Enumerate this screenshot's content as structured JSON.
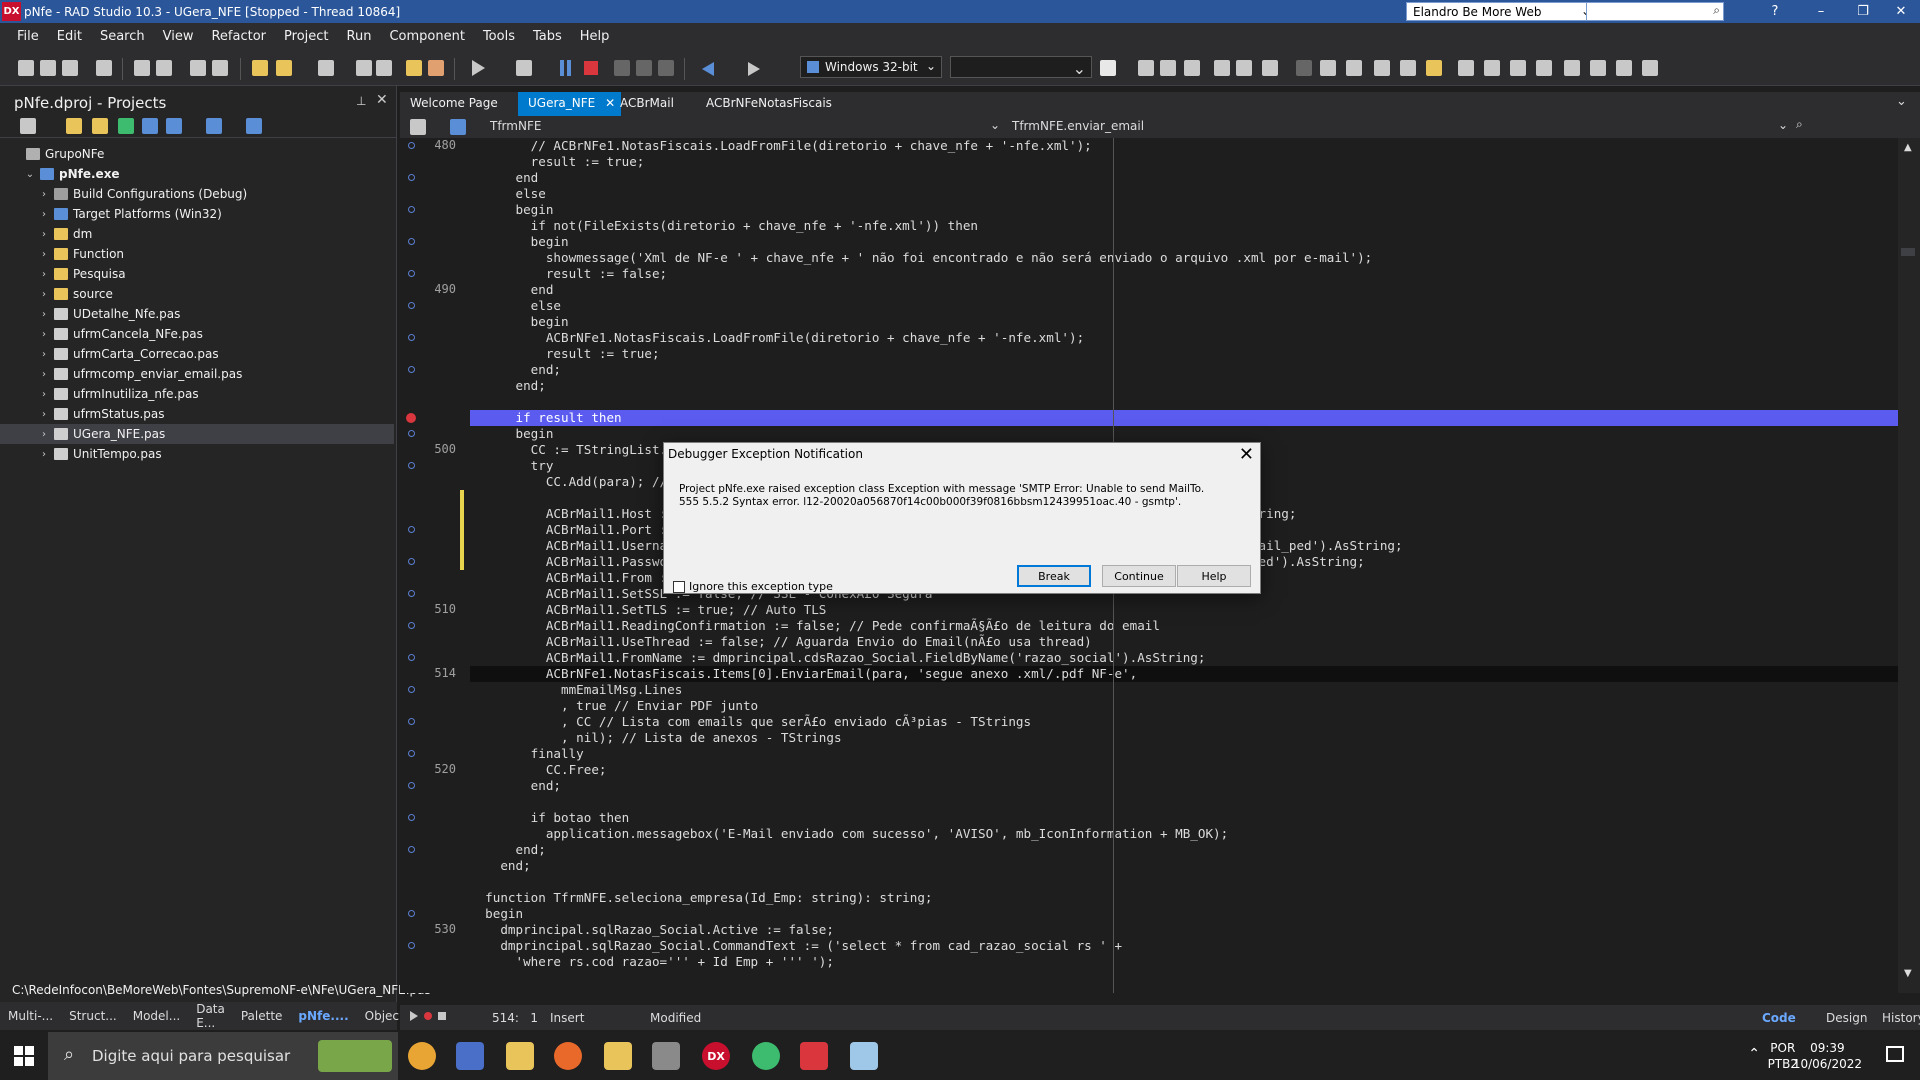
{
  "window": {
    "title": "pNfe - RAD Studio 10.3 - UGera_NFE [Stopped - Thread 10864]",
    "logo": "DX",
    "layout": "Elandro Be More Web",
    "help": "?"
  },
  "menu": [
    "File",
    "Edit",
    "Search",
    "View",
    "Refactor",
    "Project",
    "Run",
    "Component",
    "Tools",
    "Tabs",
    "Help"
  ],
  "toolbar": {
    "platform": "Windows 32-bit"
  },
  "projects": {
    "title": "pNfe.dproj - Projects",
    "tree": [
      {
        "label": "GrupoNFe",
        "indent": 0,
        "icon": "group",
        "expanded": null,
        "sel": false
      },
      {
        "label": "pNfe.exe",
        "indent": 1,
        "icon": "exe",
        "expanded": true,
        "sel": false,
        "bold": true
      },
      {
        "label": "Build Configurations (Debug)",
        "indent": 2,
        "icon": "config",
        "expanded": false,
        "sel": false
      },
      {
        "label": "Target Platforms (Win32)",
        "indent": 2,
        "icon": "platform",
        "expanded": false,
        "sel": false
      },
      {
        "label": "dm",
        "indent": 2,
        "icon": "folder",
        "expanded": false,
        "sel": false
      },
      {
        "label": "Function",
        "indent": 2,
        "icon": "folder",
        "expanded": false,
        "sel": false
      },
      {
        "label": "Pesquisa",
        "indent": 2,
        "icon": "folder",
        "expanded": false,
        "sel": false
      },
      {
        "label": "source",
        "indent": 2,
        "icon": "folder",
        "expanded": false,
        "sel": false
      },
      {
        "label": "UDetalhe_Nfe.pas",
        "indent": 2,
        "icon": "file",
        "expanded": false,
        "sel": false
      },
      {
        "label": "ufrmCancela_NFe.pas",
        "indent": 2,
        "icon": "file",
        "expanded": false,
        "sel": false
      },
      {
        "label": "ufrmCarta_Correcao.pas",
        "indent": 2,
        "icon": "file",
        "expanded": false,
        "sel": false
      },
      {
        "label": "ufrmcomp_enviar_email.pas",
        "indent": 2,
        "icon": "file",
        "expanded": false,
        "sel": false
      },
      {
        "label": "ufrmInutiliza_nfe.pas",
        "indent": 2,
        "icon": "file",
        "expanded": false,
        "sel": false
      },
      {
        "label": "ufrmStatus.pas",
        "indent": 2,
        "icon": "file",
        "expanded": false,
        "sel": false
      },
      {
        "label": "UGera_NFE.pas",
        "indent": 2,
        "icon": "file",
        "expanded": false,
        "sel": true
      },
      {
        "label": "UnitTempo.pas",
        "indent": 2,
        "icon": "file",
        "expanded": false,
        "sel": false
      }
    ],
    "path": "C:\\RedeInfocon\\BeMoreWeb\\Fontes\\SupremoNF-e\\NFe\\UGera_NFE.pas"
  },
  "bottom_tabs": [
    "Multi-...",
    "Struct...",
    "Model...",
    "Data E...",
    "Palette",
    "pNfe....",
    "Objec..."
  ],
  "editor": {
    "tabs": [
      "Welcome Page",
      "UGera_NFE",
      "ACBrMail",
      "ACBrNFeNotasFiscais"
    ],
    "active_tab": "UGera_NFE",
    "class_combo": "TfrmNFE",
    "method_combo": "TfrmNFE.enviar_email",
    "lines": [
      {
        "n": "480",
        "t": "        // ACBrNFe1.NotasFiscais.LoadFromFile(diretorio + chave_nfe + '-nfe.xml');"
      },
      {
        "n": "",
        "t": "        result := true;"
      },
      {
        "n": "",
        "t": "      end"
      },
      {
        "n": "",
        "t": "      else"
      },
      {
        "n": "",
        "t": "      begin"
      },
      {
        "n": "",
        "t": "        if not(FileExists(diretorio + chave_nfe + '-nfe.xml')) then"
      },
      {
        "n": "",
        "t": "        begin"
      },
      {
        "n": "",
        "t": "          showmessage('Xml de NF-e ' + chave_nfe + ' não foi encontrado e não será enviado o arquivo .xml por e-mail');"
      },
      {
        "n": "",
        "t": "          result := false;"
      },
      {
        "n": "490",
        "t": "        end"
      },
      {
        "n": "",
        "t": "        else"
      },
      {
        "n": "",
        "t": "        begin"
      },
      {
        "n": "",
        "t": "          ACBrNFe1.NotasFiscais.LoadFromFile(diretorio + chave_nfe + '-nfe.xml');"
      },
      {
        "n": "",
        "t": "          result := true;"
      },
      {
        "n": "",
        "t": "        end;"
      },
      {
        "n": "",
        "t": "      end;"
      },
      {
        "n": "",
        "t": ""
      },
      {
        "n": "",
        "t": "      if result then"
      },
      {
        "n": "",
        "t": "      begin"
      },
      {
        "n": "500",
        "t": "        CC := TStringList.Cr"
      },
      {
        "n": "",
        "t": "        try"
      },
      {
        "n": "",
        "t": "          CC.Add(para); // e"
      },
      {
        "n": "",
        "t": ""
      },
      {
        "n": "",
        "t": "          ACBrMail1.Host :=                                                                      ').AsString;"
      },
      {
        "n": "",
        "t": "          ACBrMail1.Port :="
      },
      {
        "n": "",
        "t": "          ACBrMail1.Usernam                                                                       me('email_ped').AsString;"
      },
      {
        "n": "",
        "t": "          ACBrMail1.Passwor                                                                        ail_ped').AsString;"
      },
      {
        "n": "",
        "t": "          ACBrMail1.From := dmprincipal.cdsRazao_Social.FieldByName('email').AsString;"
      },
      {
        "n": "",
        "t": "          ACBrMail1.SetSSL := false; // SSL - ConexÃ£o Segura"
      },
      {
        "n": "510",
        "t": "          ACBrMail1.SetTLS := true; // Auto TLS"
      },
      {
        "n": "",
        "t": "          ACBrMail1.ReadingConfirmation := false; // Pede confirmaÃ§Ã£o de leitura do email"
      },
      {
        "n": "",
        "t": "          ACBrMail1.UseThread := false; // Aguarda Envio do Email(nÃ£o usa thread)"
      },
      {
        "n": "",
        "t": "          ACBrMail1.FromName := dmprincipal.cdsRazao_Social.FieldByName('razao_social').AsString;"
      },
      {
        "n": "514",
        "t": "          ACBrNFe1.NotasFiscais.Items[0].EnviarEmail(para, 'segue anexo .xml/.pdf NF-e',"
      },
      {
        "n": "",
        "t": "            mmEmailMsg.Lines"
      },
      {
        "n": "",
        "t": "            , true // Enviar PDF junto"
      },
      {
        "n": "",
        "t": "            , CC // Lista com emails que serÃ£o enviado cÃ³pias - TStrings"
      },
      {
        "n": "",
        "t": "            , nil); // Lista de anexos - TStrings"
      },
      {
        "n": "",
        "t": "        finally"
      },
      {
        "n": "520",
        "t": "          CC.Free;"
      },
      {
        "n": "",
        "t": "        end;"
      },
      {
        "n": "",
        "t": ""
      },
      {
        "n": "",
        "t": "        if botao then"
      },
      {
        "n": "",
        "t": "          application.messagebox('E-Mail enviado com sucesso', 'AVISO', mb_IconInformation + MB_OK);"
      },
      {
        "n": "",
        "t": "      end;"
      },
      {
        "n": "",
        "t": "    end;"
      },
      {
        "n": "",
        "t": ""
      },
      {
        "n": "",
        "t": "  function TfrmNFE.seleciona_empresa(Id_Emp: string): string;"
      },
      {
        "n": "",
        "t": "  begin"
      },
      {
        "n": "530",
        "t": "    dmprincipal.sqlRazao_Social.Active := false;"
      },
      {
        "n": "",
        "t": "    dmprincipal.sqlRazao_Social.CommandText := ('select * from cad_razao_social rs ' +"
      },
      {
        "n": "",
        "t": "      'where rs.cod razao=''' + Id Emp + ''' ');"
      }
    ],
    "exec_line_index": 17,
    "current_line_index": 33
  },
  "status": {
    "position": "514:   1",
    "mode": "Insert",
    "modified": "Modified",
    "views": [
      "Code",
      "Design",
      "History"
    ]
  },
  "dialog": {
    "title": "Debugger Exception Notification",
    "message_1": "Project pNfe.exe raised exception class Exception with message 'SMTP Error: Unable to send MailTo.",
    "message_2": "555 5.5.2 Syntax error. l12-20020a056870f14c00b000f39f0816bbsm12439951oac.40 - gsmtp'.",
    "ignore_label": "Ignore this exception type",
    "break_label": "Break",
    "continue_label": "Continue",
    "help_label": "Help"
  },
  "taskbar": {
    "search_placeholder": "Digite aqui para pesquisar",
    "lang1": "POR",
    "lang2": "PTB2",
    "time": "09:39",
    "date": "10/06/2022"
  }
}
